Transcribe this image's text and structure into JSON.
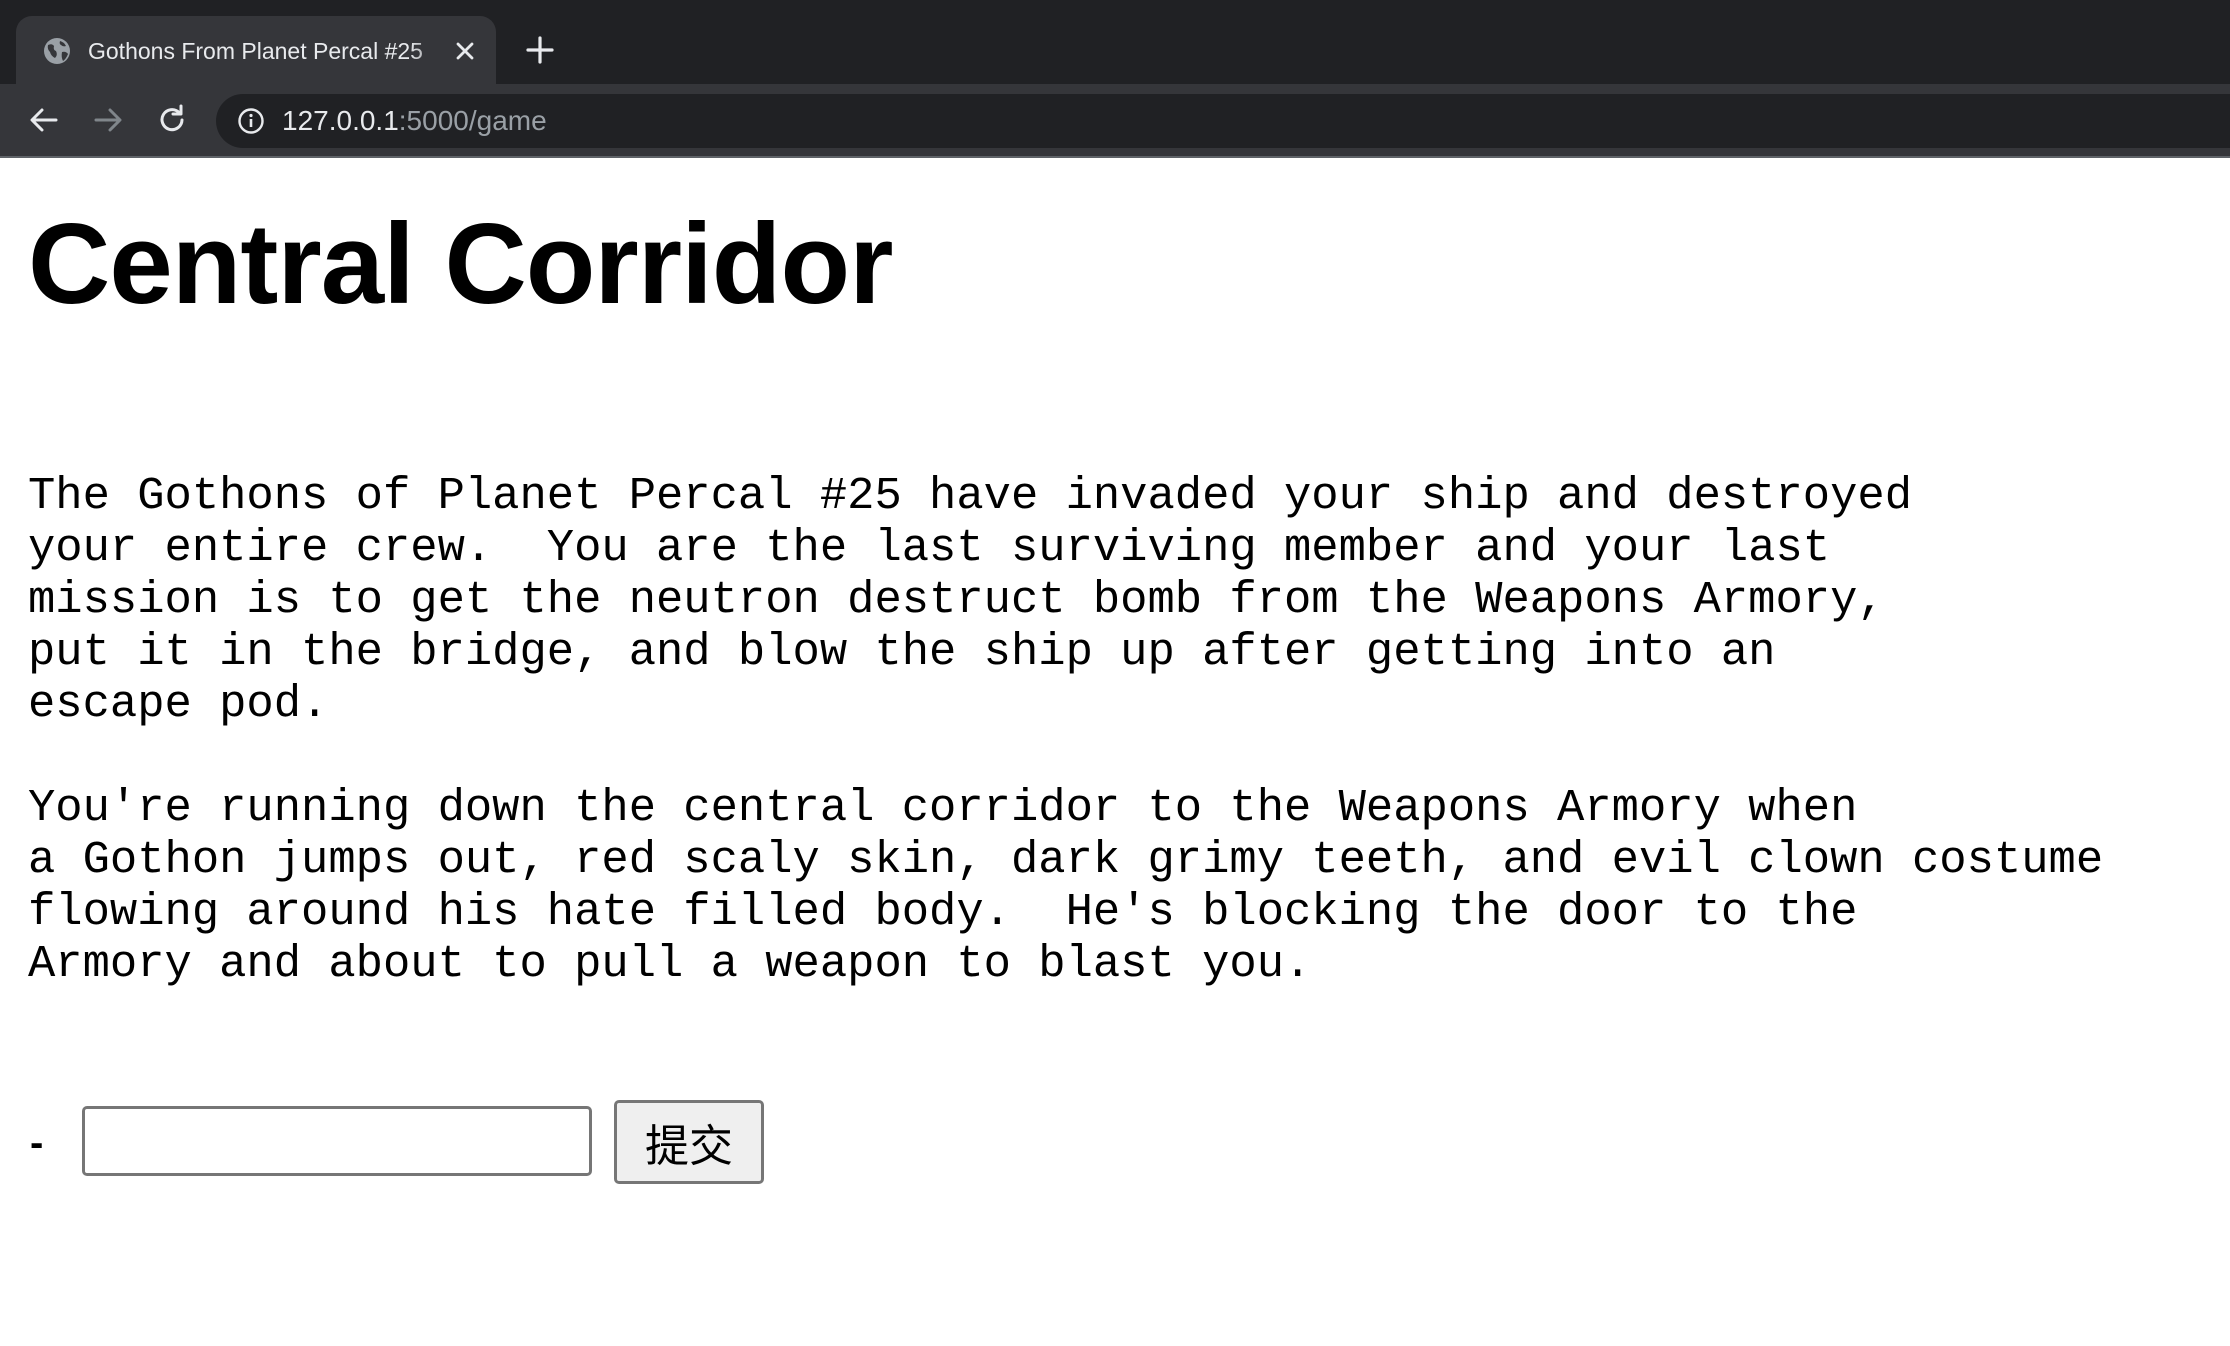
{
  "browser": {
    "tab_title": "Gothons From Planet Percal #25",
    "url_host": "127.0.0.1",
    "url_path": ":5000/game",
    "icons": {
      "favicon": "globe-icon",
      "close": "close-icon",
      "new_tab": "plus-icon",
      "back": "arrow-left-icon",
      "forward": "arrow-right-icon",
      "reload": "reload-icon",
      "site_info": "info-icon"
    }
  },
  "page": {
    "title": "Central Corridor",
    "description": "The Gothons of Planet Percal #25 have invaded your ship and destroyed\nyour entire crew.  You are the last surviving member and your last\nmission is to get the neutron destruct bomb from the Weapons Armory,\nput it in the bridge, and blow the ship up after getting into an\nescape pod.\n\nYou're running down the central corridor to the Weapons Armory when\na Gothon jumps out, red scaly skin, dark grimy teeth, and evil clown costume\nflowing around his hate filled body.  He's blocking the door to the\nArmory and about to pull a weapon to blast you.",
    "form": {
      "prompt": "-",
      "input_value": "",
      "submit_label": "提交"
    }
  }
}
